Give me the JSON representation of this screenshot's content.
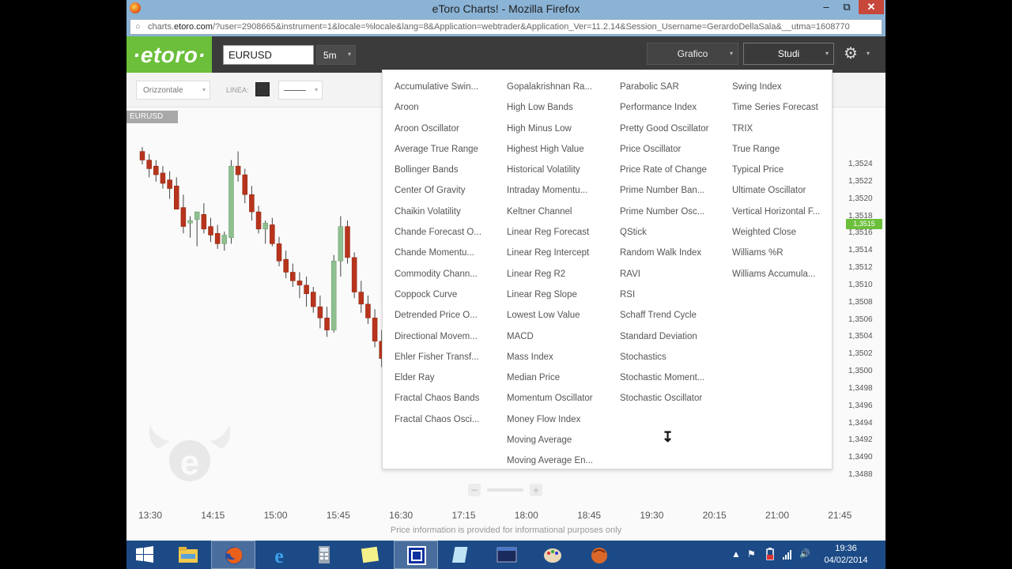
{
  "window": {
    "title": "eToro Charts! - Mozilla Firefox",
    "url_prefix": "charts.",
    "url_domain": "etoro.com",
    "url_rest": "/?user=2908665&instrument=1&locale=%locale&lang=8&Application=webtrader&Application_Ver=11.2.14&Session_Username=GerardoDellaSala&__utma=1608770",
    "min": "–",
    "max": "⧉",
    "close": "✕"
  },
  "app": {
    "logo": "·etoro·",
    "symbol": "EURUSD",
    "timeframe": "5m",
    "caret": "▾",
    "grafico_label": "Grafico",
    "studi_label": "Studi",
    "gear": "⚙"
  },
  "drawbar": {
    "orientation": "Orizzontale",
    "linea_label": "LINEA:",
    "line_color": "#333333"
  },
  "chart": {
    "symbol_tag": "EURUSD",
    "current_price": "1,3515",
    "y_labels": [
      "1,3524",
      "1,3522",
      "1,3520",
      "1,3518",
      "1,3516",
      "1,3514",
      "1,3512",
      "1,3510",
      "1,3508",
      "1,3506",
      "1,3504",
      "1,3502",
      "1,3500",
      "1,3498",
      "1,3496",
      "1,3494",
      "1,3492",
      "1,3490",
      "1,3488"
    ],
    "x_labels": [
      "13:30",
      "14:15",
      "15:00",
      "15:45",
      "16:30",
      "17:15",
      "18:00",
      "18:45",
      "19:30",
      "20:15",
      "21:00",
      "21:45"
    ],
    "disclaimer": "Price information is provided for informational purposes only",
    "zoom_minus": "−",
    "zoom_plus": "+",
    "up_color": "#8fbf8f",
    "down_color": "#b8341c",
    "candles": [
      {
        "o": 1.35255,
        "h": 1.3526,
        "l": 1.3524,
        "c": 1.35245
      },
      {
        "o": 1.35245,
        "h": 1.35252,
        "l": 1.35225,
        "c": 1.35235
      },
      {
        "o": 1.35238,
        "h": 1.35245,
        "l": 1.3522,
        "c": 1.35228
      },
      {
        "o": 1.3523,
        "h": 1.35238,
        "l": 1.35212,
        "c": 1.35218
      },
      {
        "o": 1.35222,
        "h": 1.35232,
        "l": 1.352,
        "c": 1.35212
      },
      {
        "o": 1.35215,
        "h": 1.35225,
        "l": 1.3519,
        "c": 1.35188
      },
      {
        "o": 1.3519,
        "h": 1.35205,
        "l": 1.3516,
        "c": 1.35168
      },
      {
        "o": 1.35172,
        "h": 1.3518,
        "l": 1.35155,
        "c": 1.35175
      },
      {
        "o": 1.35176,
        "h": 1.35183,
        "l": 1.35145,
        "c": 1.35185
      },
      {
        "o": 1.35182,
        "h": 1.35195,
        "l": 1.3516,
        "c": 1.35165
      },
      {
        "o": 1.35168,
        "h": 1.35178,
        "l": 1.3515,
        "c": 1.35158
      },
      {
        "o": 1.3516,
        "h": 1.3517,
        "l": 1.35142,
        "c": 1.35148
      },
      {
        "o": 1.35148,
        "h": 1.35162,
        "l": 1.3514,
        "c": 1.35158
      },
      {
        "o": 1.35155,
        "h": 1.35245,
        "l": 1.35148,
        "c": 1.35238
      },
      {
        "o": 1.35238,
        "h": 1.35255,
        "l": 1.3522,
        "c": 1.35228
      },
      {
        "o": 1.35228,
        "h": 1.35235,
        "l": 1.35195,
        "c": 1.35205
      },
      {
        "o": 1.35205,
        "h": 1.35215,
        "l": 1.35175,
        "c": 1.35185
      },
      {
        "o": 1.35185,
        "h": 1.35192,
        "l": 1.3516,
        "c": 1.35165
      },
      {
        "o": 1.35165,
        "h": 1.35175,
        "l": 1.35148,
        "c": 1.35172
      },
      {
        "o": 1.3517,
        "h": 1.35178,
        "l": 1.35145,
        "c": 1.35148
      },
      {
        "o": 1.35148,
        "h": 1.35156,
        "l": 1.35122,
        "c": 1.35128
      },
      {
        "o": 1.3513,
        "h": 1.3514,
        "l": 1.35108,
        "c": 1.35115
      },
      {
        "o": 1.35115,
        "h": 1.35125,
        "l": 1.35098,
        "c": 1.35105
      },
      {
        "o": 1.35105,
        "h": 1.35115,
        "l": 1.35085,
        "c": 1.351
      },
      {
        "o": 1.351,
        "h": 1.3511,
        "l": 1.35075,
        "c": 1.3509
      },
      {
        "o": 1.35092,
        "h": 1.35098,
        "l": 1.35068,
        "c": 1.35075
      },
      {
        "o": 1.35075,
        "h": 1.35088,
        "l": 1.3505,
        "c": 1.35062
      },
      {
        "o": 1.35062,
        "h": 1.35075,
        "l": 1.3504,
        "c": 1.35048
      },
      {
        "o": 1.35048,
        "h": 1.35135,
        "l": 1.35045,
        "c": 1.35128
      },
      {
        "o": 1.35128,
        "h": 1.3518,
        "l": 1.3511,
        "c": 1.35168
      },
      {
        "o": 1.35168,
        "h": 1.35175,
        "l": 1.35125,
        "c": 1.35132
      },
      {
        "o": 1.35132,
        "h": 1.35138,
        "l": 1.35085,
        "c": 1.35092
      },
      {
        "o": 1.35092,
        "h": 1.35105,
        "l": 1.35068,
        "c": 1.35078
      },
      {
        "o": 1.35078,
        "h": 1.35088,
        "l": 1.35055,
        "c": 1.35062
      },
      {
        "o": 1.35062,
        "h": 1.35072,
        "l": 1.35028,
        "c": 1.35035
      },
      {
        "o": 1.35035,
        "h": 1.35048,
        "l": 1.35005,
        "c": 1.35015
      },
      {
        "o": 1.35015,
        "h": 1.35025,
        "l": 1.34985,
        "c": 1.34995
      },
      {
        "o": 1.34995,
        "h": 1.35005,
        "l": 1.34962,
        "c": 1.34968
      }
    ]
  },
  "studies_menu": {
    "columns": [
      [
        "Accumulative Swin...",
        "Aroon",
        "Aroon Oscillator",
        "Average True Range",
        "Bollinger Bands",
        "Center Of Gravity",
        "Chaikin Volatility",
        "Chande Forecast O...",
        "Chande Momentu...",
        "Commodity Chann...",
        "Coppock Curve",
        "Detrended Price O...",
        "Directional Movem...",
        "Ehler Fisher Transf...",
        "Elder Ray",
        "Fractal Chaos Bands",
        "Fractal Chaos Osci..."
      ],
      [
        "Gopalakrishnan Ra...",
        "High Low Bands",
        "High Minus Low",
        "Highest High Value",
        "Historical Volatility",
        "Intraday Momentu...",
        "Keltner Channel",
        "Linear Reg Forecast",
        "Linear Reg Intercept",
        "Linear Reg R2",
        "Linear Reg Slope",
        "Lowest Low Value",
        "MACD",
        "Mass Index",
        "Median Price",
        "Momentum Oscillator",
        "Money Flow Index",
        "Moving Average",
        "Moving Average En..."
      ],
      [
        "Parabolic SAR",
        "Performance Index",
        "Pretty Good Oscillator",
        "Price Oscillator",
        "Price Rate of Change",
        "Prime Number Ban...",
        "Prime Number Osc...",
        "QStick",
        "Random Walk Index",
        "RAVI",
        "RSI",
        "Schaff Trend Cycle",
        "Standard Deviation",
        "Stochastics",
        "Stochastic Moment...",
        "Stochastic Oscillator"
      ],
      [
        "Swing Index",
        "Time Series Forecast",
        "TRIX",
        "True Range",
        "Typical Price",
        "Ultimate Oscillator",
        "Vertical Horizontal F...",
        "Weighted Close",
        "Williams %R",
        "Williams Accumula..."
      ]
    ]
  },
  "taskbar": {
    "clock_time": "19:36",
    "clock_date": "04/02/2014",
    "tray_up": "▲",
    "tray_flag": "⚑",
    "tray_speaker": "🔊"
  }
}
